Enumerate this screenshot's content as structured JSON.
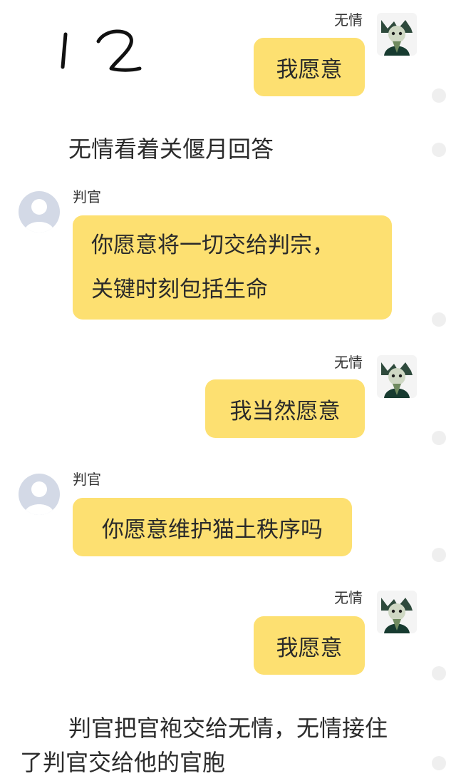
{
  "annotation": {
    "handwritten_number": "12"
  },
  "messages": [
    {
      "side": "right",
      "sender": "无情",
      "text": "我愿意"
    },
    {
      "side": "left",
      "sender": "判官",
      "line1": "你愿意将一切交给判宗，",
      "line2": "关键时刻包括生命"
    },
    {
      "side": "right",
      "sender": "无情",
      "text": "我当然愿意"
    },
    {
      "side": "left",
      "sender": "判官",
      "text": "你愿意维护猫土秩序吗"
    },
    {
      "side": "right",
      "sender": "无情",
      "text": "我愿意"
    }
  ],
  "narration": {
    "first": "无情看着关偃月回答",
    "last_line1": "判官把官袍交给无情，无情接住",
    "last_line2": "了判官交给他的官胞"
  },
  "icons": {
    "right_avatar": "cat-character-avatar-icon",
    "left_avatar": "default-user-avatar-icon"
  },
  "colors": {
    "bubble": "#fde071",
    "background": "#ffffff",
    "default_avatar": "#d3d9e6"
  }
}
